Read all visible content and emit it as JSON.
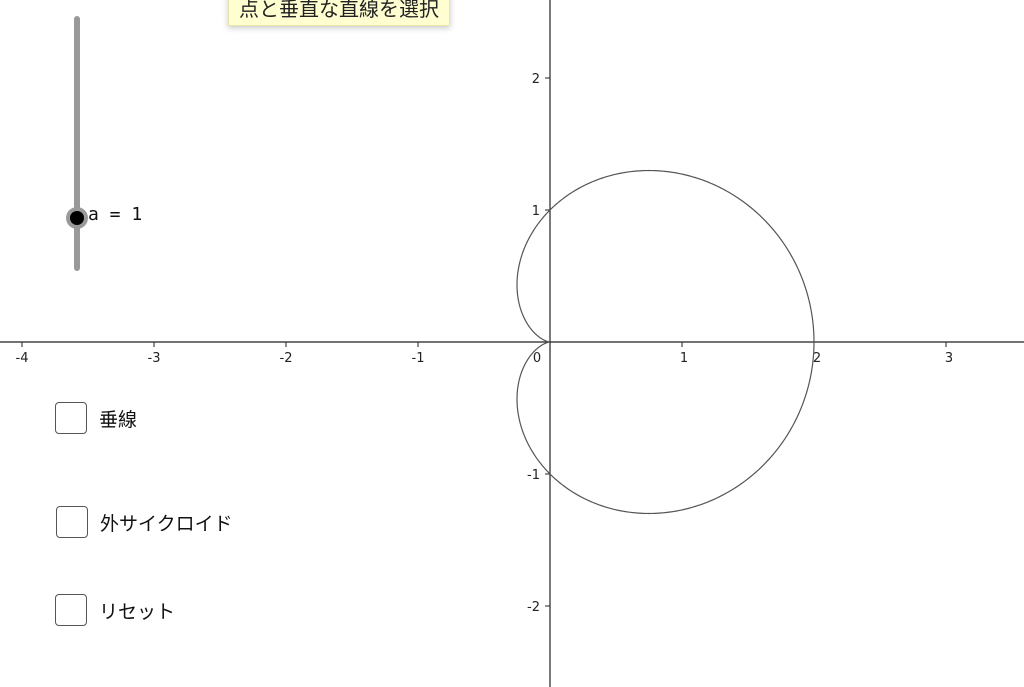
{
  "tooltip": {
    "text": "点と垂直な直線を選択"
  },
  "slider": {
    "label": "a = 1",
    "value": 1
  },
  "checkboxes": [
    {
      "label": "垂線",
      "checked": false
    },
    {
      "label": "外サイクロイド",
      "checked": false
    },
    {
      "label": "リセット",
      "checked": false
    }
  ],
  "axes": {
    "x_ticks": [
      "-4",
      "-3",
      "-2",
      "-1",
      "0",
      "1",
      "2",
      "3"
    ],
    "y_ticks": [
      "2",
      "1",
      "-1",
      "-2"
    ]
  },
  "chart_data": {
    "type": "line",
    "curve": "cardioid r = a(1 + cos θ)",
    "a": 1,
    "xlim": [
      -4.1,
      3.6
    ],
    "ylim": [
      -2.6,
      2.6
    ],
    "x_ticks": [
      -4,
      -3,
      -2,
      -1,
      0,
      1,
      2,
      3
    ],
    "y_ticks": [
      -2,
      -1,
      1,
      2
    ]
  },
  "colors": {
    "curve": "#555555",
    "axis": "#222222",
    "slider_track": "#999999",
    "tooltip_bg": "#fffed1"
  }
}
